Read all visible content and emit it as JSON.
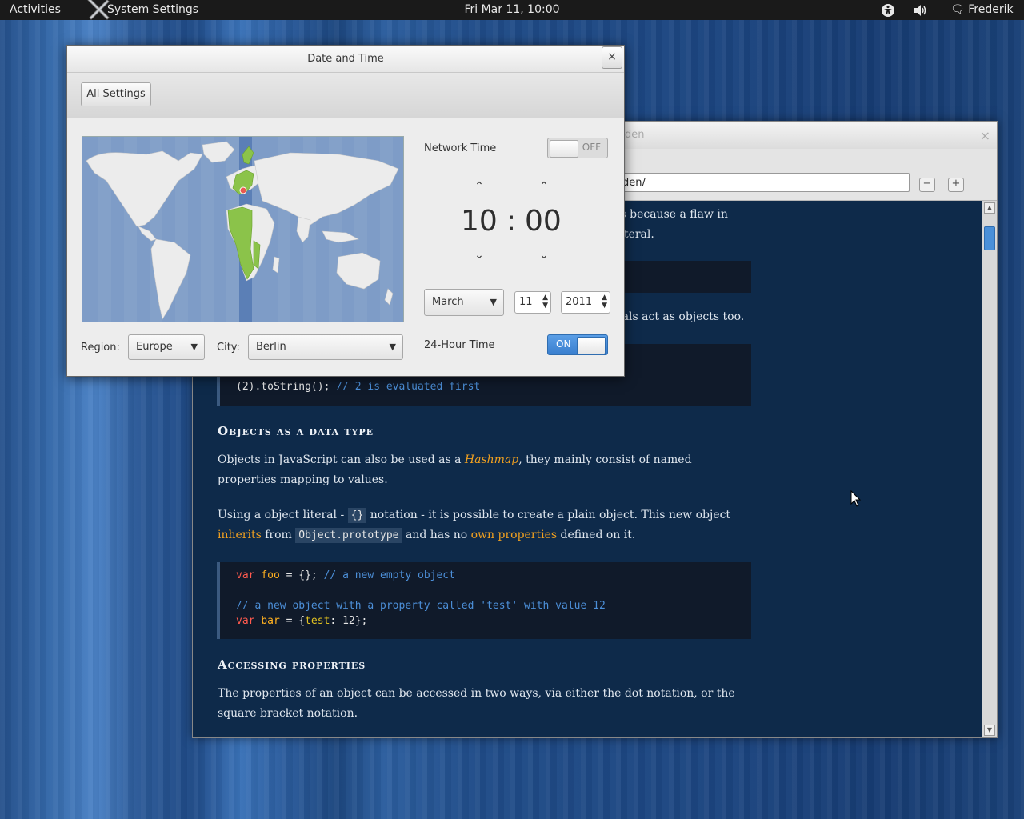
{
  "topbar": {
    "activities": "Activities",
    "app_name": "System Settings",
    "clock": "Fri Mar 11, 10:00",
    "user": "Frederik"
  },
  "browser": {
    "title_fragment": "den",
    "url_fragment": "den/",
    "zoom_out": "−",
    "zoom_in": "+",
    "content": {
      "p1_line1": "is because a flaw in",
      "p1_line2": "literal.",
      "p2": "rals act as objects too.",
      "code1_line": "(2).toString();",
      "code1_comment": "// 2 is evaluated first",
      "heading1": "Objects as a data type",
      "p3_before": "Objects in JavaScript can also be used as a ",
      "p3_link": "Hashmap",
      "p3_after": ", they mainly consist of named properties mapping to values.",
      "p4_a": "Using a object literal - ",
      "p4_code1": "{}",
      "p4_b": " notation - it is possible to create a plain object. This new object ",
      "p4_link1": "inherits",
      "p4_c": " from ",
      "p4_code2": "Object.prototype",
      "p4_d": " and has no ",
      "p4_link2": "own properties",
      "p4_e": " defined on it.",
      "code2_kw1": "var",
      "code2_var1": "foo",
      "code2_rest1": " = {};",
      "code2_cm1": "// a new empty object",
      "code2_cm2": "// a new object with a property called 'test' with value 12",
      "code2_kw2": "var",
      "code2_var2": "bar",
      "code2_rest2a": " = {",
      "code2_prop": "test",
      "code2_rest2b": ": 12};",
      "heading2": "Accessing properties",
      "p5": "The properties of an object can be accessed in two ways, via either the dot notation, or the square bracket notation."
    }
  },
  "dialog": {
    "title": "Date and Time",
    "close": "×",
    "all_settings": "All Settings",
    "region_label": "Region:",
    "region_value": "Europe",
    "city_label": "City:",
    "city_value": "Berlin",
    "network_time_label": "Network Time",
    "network_time_state": "OFF",
    "hours": "10",
    "colon": ":",
    "minutes": "00",
    "month": "March",
    "day": "11",
    "year": "2011",
    "hour24_label": "24-Hour Time",
    "hour24_state": "ON"
  },
  "colors": {
    "accent": "#4a90d9",
    "content_bg": "#0e2a4a",
    "link": "#f0a020"
  }
}
